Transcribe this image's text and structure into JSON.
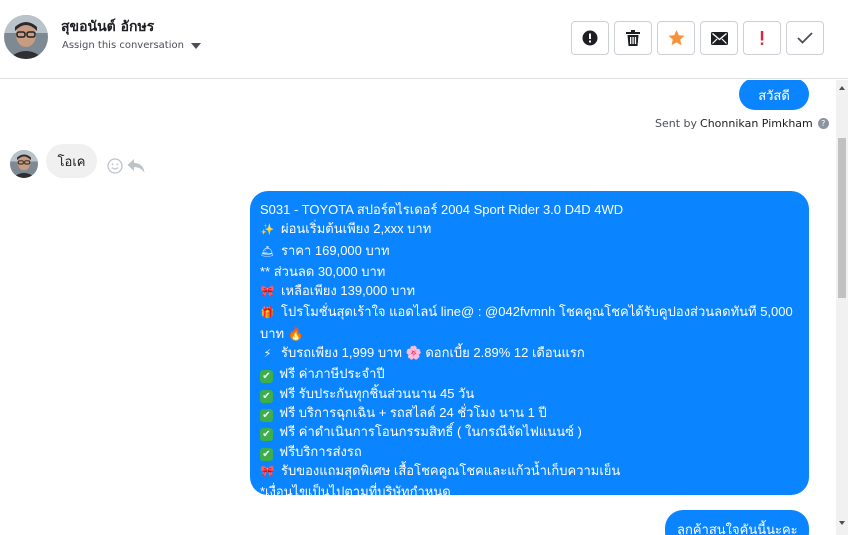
{
  "header": {
    "contact_name": "สุขอนันต์ อักษร",
    "assign_label": "Assign this conversation",
    "actions": [
      {
        "name": "mark-spam-button",
        "icon": "alert-circle-icon"
      },
      {
        "name": "delete-button",
        "icon": "trash-icon"
      },
      {
        "name": "star-button",
        "icon": "star-icon"
      },
      {
        "name": "mark-unread-button",
        "icon": "envelope-icon"
      },
      {
        "name": "flag-important-button",
        "icon": "exclamation-icon"
      },
      {
        "name": "mark-done-button",
        "icon": "check-icon"
      }
    ]
  },
  "conversation": {
    "msg_hello": "สวัสดีคะ",
    "sent_by_prefix": "Sent by",
    "sent_by_name": "Chonnikan Pimkham",
    "info_glyph": "?",
    "msg_customer": "โอเค",
    "long_message": {
      "lines": [
        {
          "icon": "",
          "text": "S031 - TOYOTA สปอร์ตไรเดอร์ 2004 Sport Rider 3.0 D4D 4WD"
        },
        {
          "icon": "✨",
          "text": "ผ่อนเริ่มต้นเพียง 2,xxx บาท"
        },
        {
          "icon": "🛎",
          "text": "ราคา 169,000 บาท"
        },
        {
          "icon": "",
          "text": "** ส่วนลด 30,000 บาท"
        },
        {
          "icon": "🎀",
          "text": "เหลือเพียง 139,000 บาท"
        },
        {
          "icon": "🎁",
          "text": "โปรโมชั่นสุดเร้าใจ แอดไลน์ line@ : @042fvmnh โชคคูณโชคได้รับคูปองส่วนลดทันที 5,000 บาท 🔥"
        },
        {
          "icon": "⚡",
          "text": "รับรถเพียง 1,999 บาท 🌸 ดอกเบี้ย 2.89% 12 เดือนแรก"
        },
        {
          "icon": "✔",
          "text": "ฟรี ค่าภาษีประจำปี"
        },
        {
          "icon": "✔",
          "text": "ฟรี รับประกันทุกชิ้นส่วนนาน 45 วัน"
        },
        {
          "icon": "✔",
          "text": "ฟรี บริการฉุกเฉิน + รถสไลด์ 24 ชั่วโมง นาน 1 ปี"
        },
        {
          "icon": "✔",
          "text": "ฟรี ค่าดำเนินการโอนกรรมสิทธิ์ ( ในกรณีจัดไฟแนนซ์ )"
        },
        {
          "icon": "✔",
          "text": "ฟรีบริการส่งรถ"
        },
        {
          "icon": "🎀",
          "text": "รับของแถมสุดพิเศษ เสื้อโชคคูณโชคและแก้วน้ำเก็บความเย็น"
        },
        {
          "icon": "",
          "text": "*เงื่อนไขเป็นไปตามที่บริษัทกำหนด"
        }
      ]
    },
    "msg_last": "ลูกค้าสนใจคันนี้นะคะ"
  },
  "colors": {
    "outgoing_bubble": "#0b84ff",
    "incoming_bubble": "#f1f0f0",
    "star": "#f7923a",
    "flag": "#e41e3f"
  }
}
